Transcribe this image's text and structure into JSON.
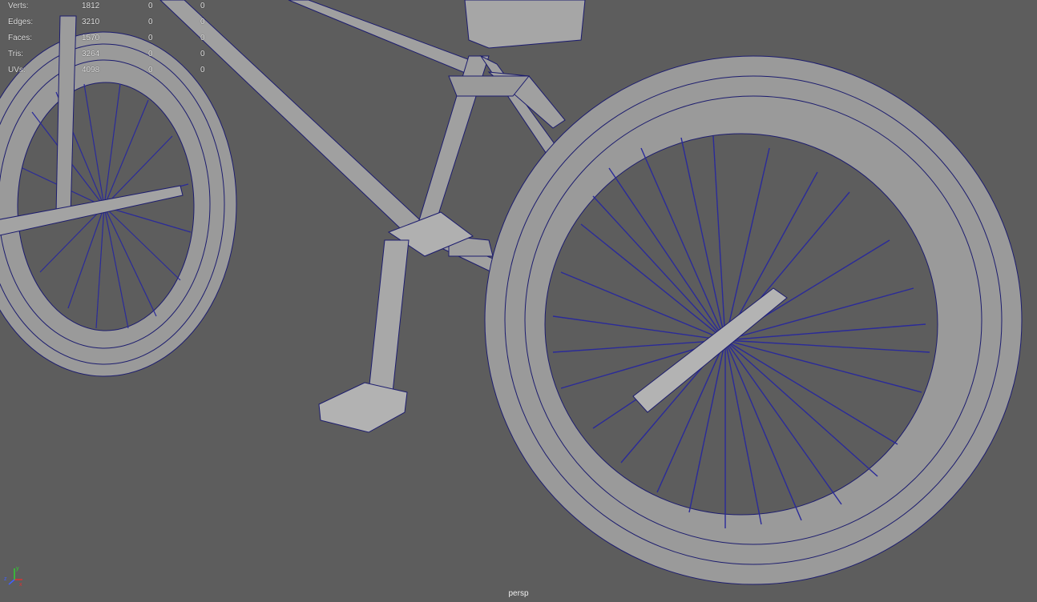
{
  "hud": {
    "rows": [
      {
        "label": "Verts:",
        "v1": "1812",
        "v2": "0",
        "v3": "0"
      },
      {
        "label": "Edges:",
        "v1": "3210",
        "v2": "0",
        "v3": "0"
      },
      {
        "label": "Faces:",
        "v1": "1570",
        "v2": "0",
        "v3": "0"
      },
      {
        "label": "Tris:",
        "v1": "3264",
        "v2": "0",
        "v3": "0"
      },
      {
        "label": "UVs:",
        "v1": "4098",
        "v2": "0",
        "v3": "0"
      }
    ]
  },
  "camera": {
    "name": "persp"
  },
  "axis": {
    "x": "x",
    "y": "y",
    "z": "z"
  },
  "colors": {
    "background": "#5d5d5d",
    "mesh": "#8c8c8c",
    "wire": "#1c1c6e",
    "spoke": "#2a2a9a",
    "axis_x": "#e03030",
    "axis_y": "#30d030",
    "axis_z": "#4060ff"
  }
}
